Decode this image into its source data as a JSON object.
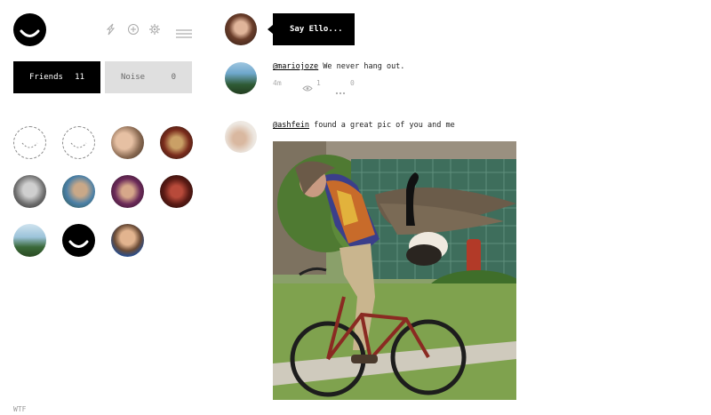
{
  "sidebar": {
    "tabs": [
      {
        "label": "Friends",
        "count": "11"
      },
      {
        "label": "Noise",
        "count": "0"
      }
    ],
    "header_icons": [
      "lightning-icon",
      "add-icon",
      "gear-icon",
      "menu-icon"
    ],
    "footer_link": "WTF"
  },
  "feed": {
    "say_ello": "Say Ello...",
    "posts": [
      {
        "author": "@mariojoze",
        "text": " We never hang out.",
        "time": "4m",
        "views": "1",
        "more": "0"
      },
      {
        "author": "@ashfein",
        "text": " found a great pic of you and me"
      }
    ]
  },
  "colors": {
    "accent": "#000000",
    "muted": "#aaaaaa",
    "noise_tab_bg": "#dfdfdf"
  }
}
